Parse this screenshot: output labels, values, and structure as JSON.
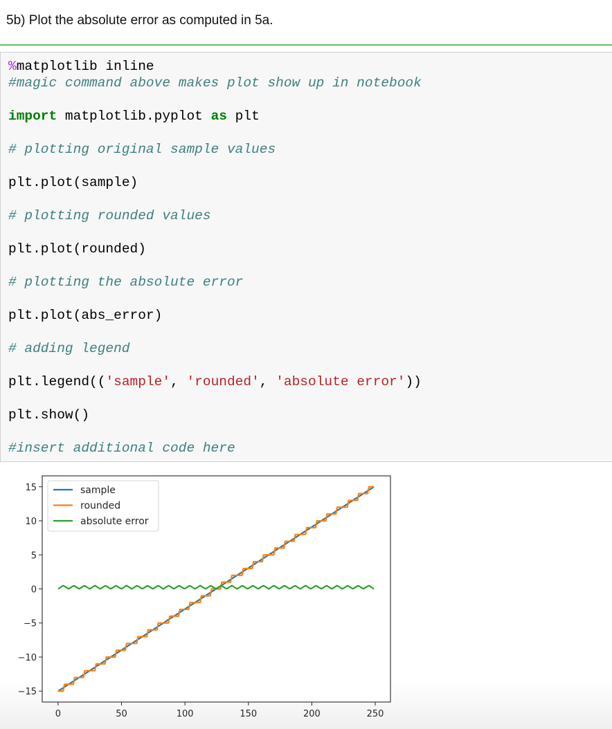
{
  "markdown_cell": {
    "text": "5b) Plot the absolute error as computed in 5a."
  },
  "code_cell": {
    "lines": [
      [
        {
          "t": "mg",
          "v": "%"
        },
        {
          "t": "",
          "v": "matplotlib inline"
        }
      ],
      [
        {
          "t": "cm",
          "v": "#magic command above makes plot show up in notebook"
        }
      ],
      [],
      [
        {
          "t": "kw",
          "v": "import"
        },
        {
          "t": "",
          "v": " matplotlib.pyplot "
        },
        {
          "t": "kw",
          "v": "as"
        },
        {
          "t": "",
          "v": " plt"
        }
      ],
      [],
      [
        {
          "t": "cm",
          "v": "# plotting original sample values"
        }
      ],
      [],
      [
        {
          "t": "",
          "v": "plt.plot(sample)"
        }
      ],
      [],
      [
        {
          "t": "cm",
          "v": "# plotting rounded values"
        }
      ],
      [],
      [
        {
          "t": "",
          "v": "plt.plot(rounded)"
        }
      ],
      [],
      [
        {
          "t": "cm",
          "v": "# plotting the absolute error"
        }
      ],
      [],
      [
        {
          "t": "",
          "v": "plt.plot(abs_error)"
        }
      ],
      [],
      [
        {
          "t": "cm",
          "v": "# adding legend"
        }
      ],
      [],
      [
        {
          "t": "",
          "v": "plt.legend(("
        },
        {
          "t": "st",
          "v": "'sample'"
        },
        {
          "t": "",
          "v": ", "
        },
        {
          "t": "st",
          "v": "'rounded'"
        },
        {
          "t": "",
          "v": ", "
        },
        {
          "t": "st",
          "v": "'absolute error'"
        },
        {
          "t": "",
          "v": "))"
        }
      ],
      [],
      [
        {
          "t": "",
          "v": "plt.show()"
        }
      ],
      [],
      [
        {
          "t": "cm",
          "v": "#insert additional code here"
        }
      ]
    ]
  },
  "colors": {
    "cell_divider": "#66bb6a",
    "keyword": "#008000",
    "comment": "#408080",
    "string": "#ba2121",
    "magic": "#aa22ff",
    "sample": "#1f77b4",
    "rounded": "#ff7f0e",
    "absolute_error": "#2ca02c"
  },
  "chart_data": {
    "type": "line",
    "title": "",
    "xlabel": "",
    "ylabel": "",
    "xlim": [
      -12.5,
      262
    ],
    "ylim": [
      -16.6,
      16.6
    ],
    "xticks": [
      0,
      50,
      100,
      150,
      200,
      250
    ],
    "xtick_labels": [
      "0",
      "50",
      "100",
      "150",
      "200",
      "250"
    ],
    "yticks": [
      15,
      10,
      5,
      0,
      -5,
      -10,
      -15
    ],
    "ytick_labels": [
      "15",
      "10",
      "5",
      "0",
      "−5",
      "−10",
      "−15"
    ],
    "grid": false,
    "legend_position": "upper-left",
    "n_points": 250,
    "series": [
      {
        "name": "sample",
        "color": "#1f77b4",
        "description": "linear ramp from -15 to 15 over indices 0..249",
        "start": -15,
        "end": 15
      },
      {
        "name": "rounded",
        "color": "#ff7f0e",
        "description": "round(sample) - integer staircase from -15 to 15"
      },
      {
        "name": "absolute error",
        "color": "#2ca02c",
        "description": "|sample - rounded|, oscillates between 0 and 0.5",
        "min": 0,
        "max": 0.5
      }
    ],
    "legend": [
      "sample",
      "rounded",
      "absolute error"
    ]
  }
}
